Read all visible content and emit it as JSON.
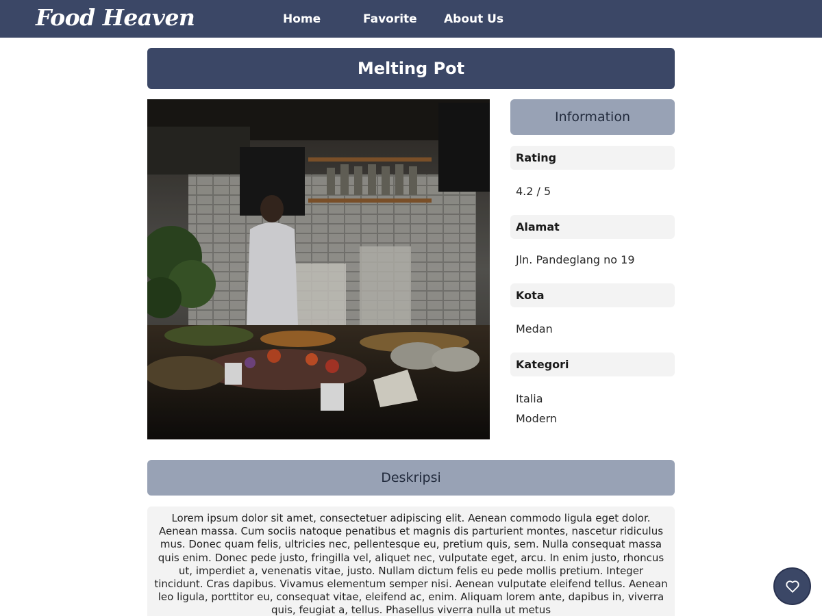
{
  "header": {
    "brand": "Food Heaven",
    "nav": [
      {
        "label": "Home"
      },
      {
        "label": "Favorite"
      },
      {
        "label": "About Us"
      }
    ]
  },
  "restaurant": {
    "name": "Melting Pot",
    "photo_icon": "restaurant-photo"
  },
  "information": {
    "heading": "Information",
    "rating_label": "Rating",
    "rating_value": "4.2 / 5",
    "address_label": "Alamat",
    "address_value": "Jln. Pandeglang no 19",
    "city_label": "Kota",
    "city_value": "Medan",
    "category_label": "Kategori",
    "categories": [
      "Italia",
      "Modern"
    ]
  },
  "description": {
    "heading": "Deskripsi",
    "text": "Lorem ipsum dolor sit amet, consectetuer adipiscing elit. Aenean commodo ligula eget dolor. Aenean massa. Cum sociis natoque penatibus et magnis dis parturient montes, nascetur ridiculus mus. Donec quam felis, ultricies nec, pellentesque eu, pretium quis, sem. Nulla consequat massa quis enim. Donec pede justo, fringilla vel, aliquet nec, vulputate eget, arcu. In enim justo, rhoncus ut, imperdiet a, venenatis vitae, justo. Nullam dictum felis eu pede mollis pretium. Integer tincidunt. Cras dapibus. Vivamus elementum semper nisi. Aenean vulputate eleifend tellus. Aenean leo ligula, porttitor eu, consequat vitae, eleifend ac, enim. Aliquam lorem ante, dapibus in, viverra quis, feugiat a, tellus. Phasellus viverra nulla ut metus"
  },
  "favorite_button": {
    "icon": "heart-icon"
  },
  "colors": {
    "primary": "#3b4766",
    "secondary": "#98a2b5",
    "panel": "#f3f3f3"
  }
}
